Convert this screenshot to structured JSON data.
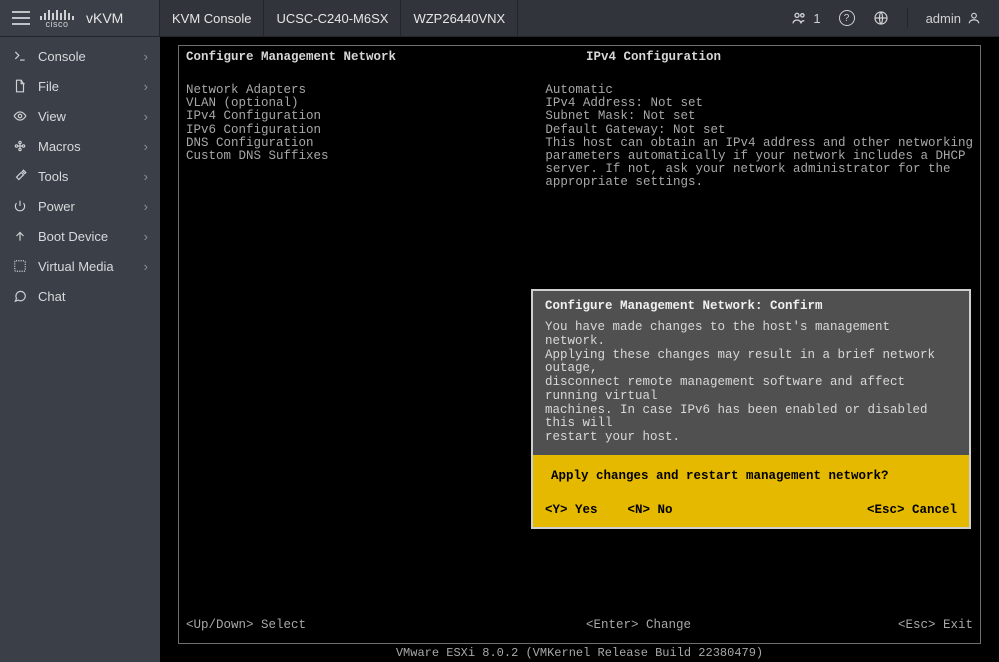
{
  "header": {
    "app_name": "vKVM",
    "segments": [
      "KVM Console",
      "UCSC-C240-M6SX",
      "WZP26440VNX"
    ],
    "user_count": "1",
    "admin_label": "admin"
  },
  "sidebar": {
    "items": [
      {
        "label": "Console",
        "has_chevron": true
      },
      {
        "label": "File",
        "has_chevron": true
      },
      {
        "label": "View",
        "has_chevron": true
      },
      {
        "label": "Macros",
        "has_chevron": true
      },
      {
        "label": "Tools",
        "has_chevron": true
      },
      {
        "label": "Power",
        "has_chevron": true
      },
      {
        "label": "Boot Device",
        "has_chevron": true
      },
      {
        "label": "Virtual Media",
        "has_chevron": true
      },
      {
        "label": "Chat",
        "has_chevron": false
      }
    ]
  },
  "console": {
    "header_left": "Configure Management Network",
    "header_right": "IPv4 Configuration",
    "left_lines": [
      "Network Adapters",
      "VLAN (optional)",
      "",
      "IPv4 Configuration",
      "IPv6 Configuration",
      "DNS Configuration",
      "Custom DNS Suffixes"
    ],
    "right_lines": [
      "Automatic",
      "",
      "IPv4 Address: Not set",
      "Subnet Mask: Not set",
      "Default Gateway: Not set",
      "",
      "This host can obtain an IPv4 address and other networking",
      "parameters automatically if your network includes a DHCP",
      "server. If not, ask your network administrator for the",
      "appropriate settings."
    ],
    "hints": {
      "left": "<Up/Down> Select",
      "center": "<Enter> Change",
      "right": "<Esc> Exit"
    },
    "build_line": "VMware ESXi 8.0.2 (VMKernel Release Build 22380479)"
  },
  "dialog": {
    "title": "Configure Management Network: Confirm",
    "body": "You have made changes to the host's management network.\nApplying these changes may result in a brief network outage,\ndisconnect remote management software and affect running virtual\nmachines. In case IPv6 has been enabled or disabled this will\nrestart your host.",
    "question": "Apply changes and restart management network?",
    "key_yes": "<Y> Yes",
    "key_no": "<N> No",
    "key_cancel": "<Esc> Cancel"
  }
}
